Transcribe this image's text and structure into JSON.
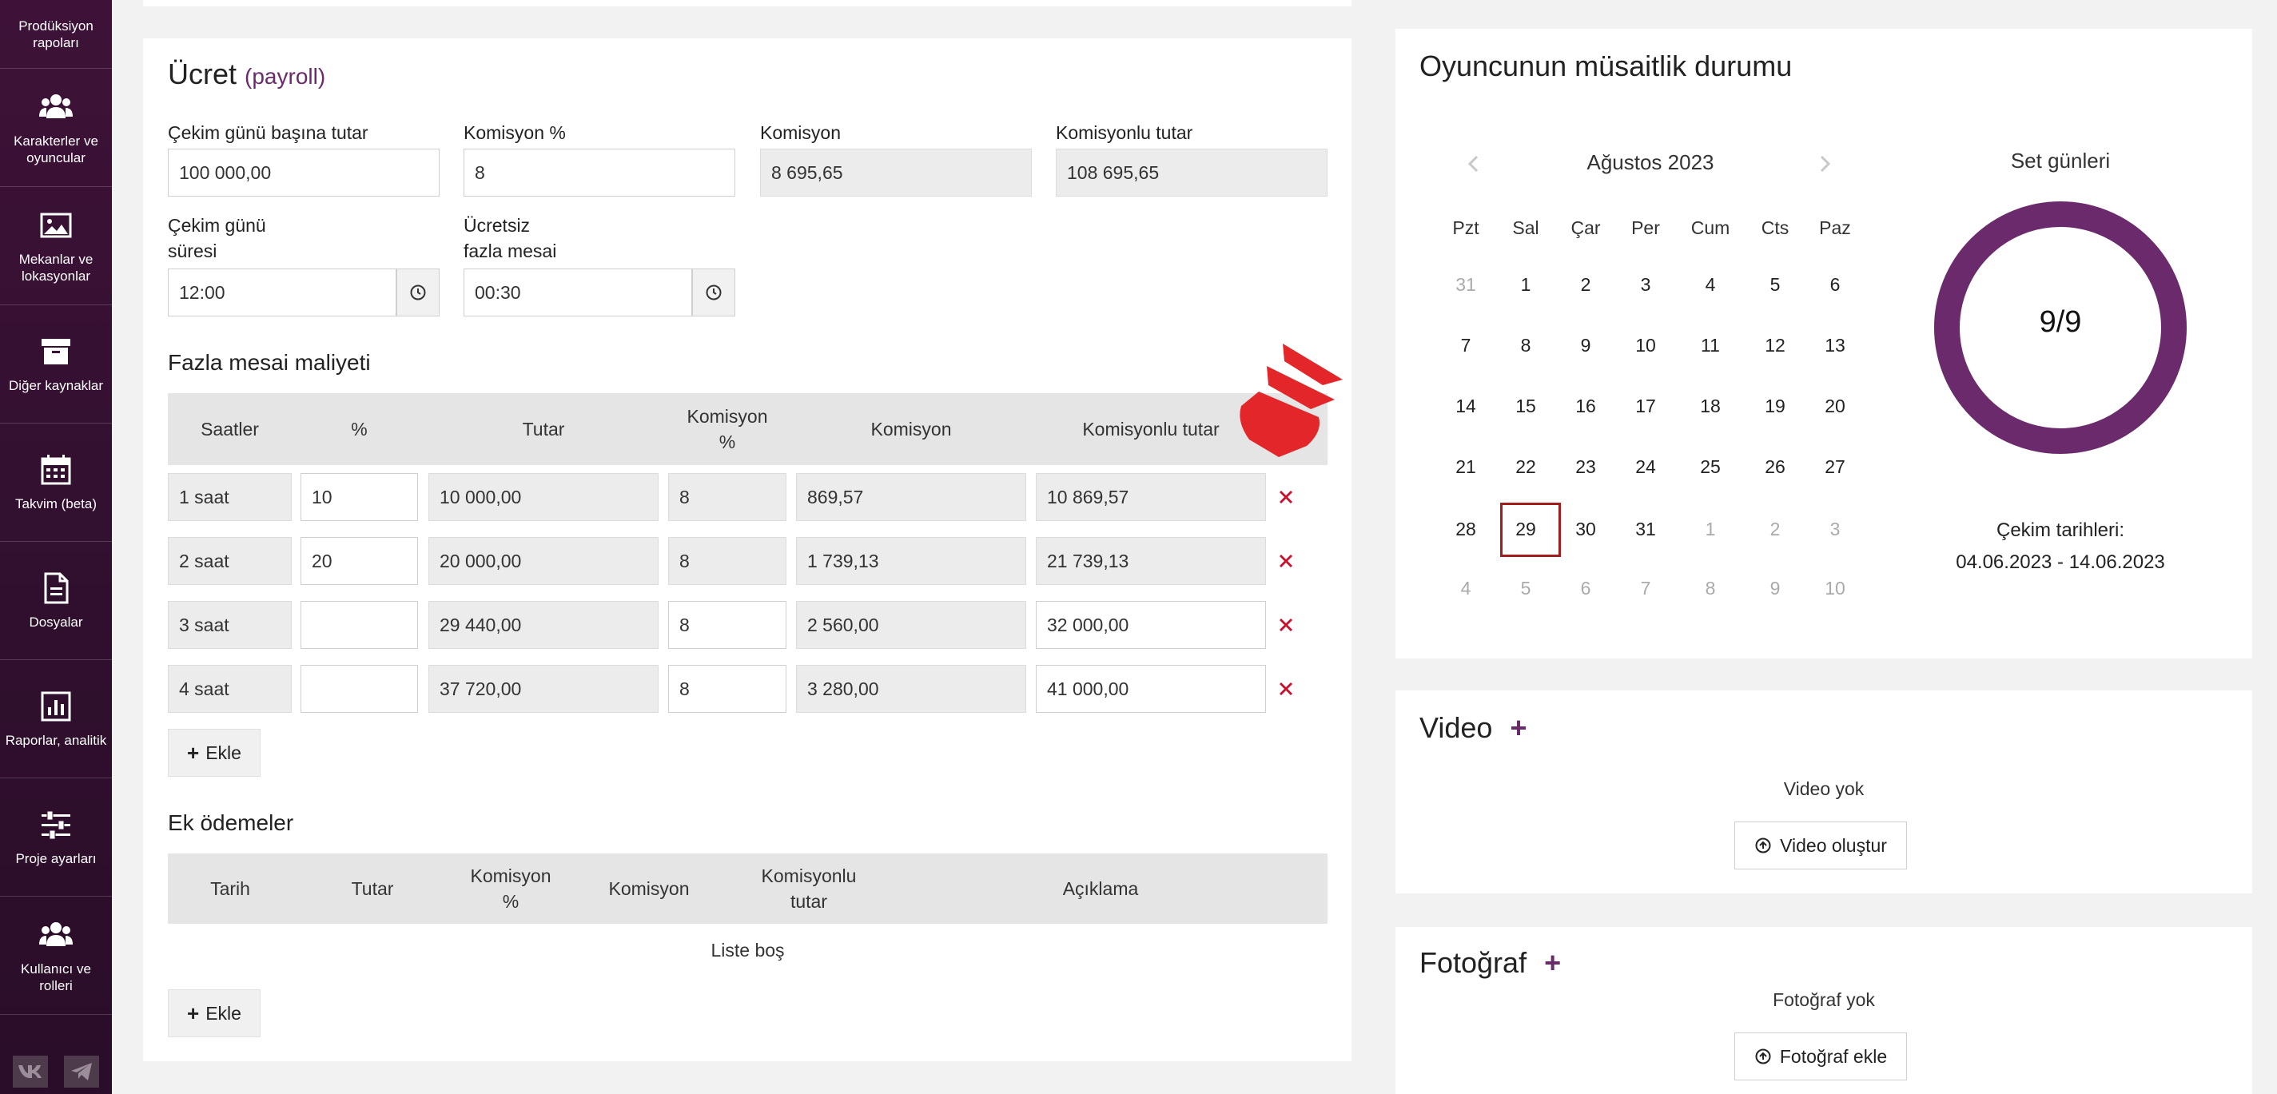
{
  "sidebar": {
    "items": [
      {
        "label": "Prodüksiyon rapoları",
        "icon": "document-icon"
      },
      {
        "label": "Karakterler ve oyuncular",
        "icon": "users-icon"
      },
      {
        "label": "Mekanlar ve lokasyonlar",
        "icon": "image-icon"
      },
      {
        "label": "Diğer kaynaklar",
        "icon": "archive-icon"
      },
      {
        "label": "Takvim (beta)",
        "icon": "calendar-icon"
      },
      {
        "label": "Dosyalar",
        "icon": "file-icon"
      },
      {
        "label": "Raporlar, analitik",
        "icon": "bar-chart-icon"
      },
      {
        "label": "Proje ayarları",
        "icon": "sliders-icon"
      },
      {
        "label": "Kullanıcı ve rolleri",
        "icon": "users-icon"
      }
    ],
    "social": [
      "vk-icon",
      "telegram-icon"
    ]
  },
  "fee": {
    "title": "Ücret",
    "subtitle": "(payroll)",
    "per_day_label": "Çekim günü başına tutar",
    "per_day_value": "100 000,00",
    "commission_pct_label": "Komisyon %",
    "commission_pct_value": "8",
    "commission_label": "Komisyon",
    "commission_value": "8 695,65",
    "with_commission_label": "Komisyonlu tutar",
    "with_commission_value": "108 695,65",
    "day_duration_label_1": "Çekim günü",
    "day_duration_label_2": "süresi",
    "day_duration_value": "12:00",
    "free_overtime_label_1": "Ücretsiz",
    "free_overtime_label_2": "fazla mesai",
    "free_overtime_value": "00:30"
  },
  "overtime": {
    "title": "Fazla mesai maliyeti",
    "headers": {
      "hours": "Saatler",
      "pct": "%",
      "amount": "Tutar",
      "comm_pct_1": "Komisyon",
      "comm_pct_2": "%",
      "comm": "Komisyon",
      "total": "Komisyonlu tutar"
    },
    "rows": [
      {
        "hours": "1 saat",
        "pct": "10",
        "amount": "10 000,00",
        "comm_pct": "8",
        "comm": "869,57",
        "total": "10 869,57"
      },
      {
        "hours": "2 saat",
        "pct": "20",
        "amount": "20 000,00",
        "comm_pct": "8",
        "comm": "1 739,13",
        "total": "21 739,13"
      },
      {
        "hours": "3 saat",
        "pct": "",
        "amount": "29 440,00",
        "comm_pct": "8",
        "comm": "2 560,00",
        "total": "32 000,00"
      },
      {
        "hours": "4 saat",
        "pct": "",
        "amount": "37 720,00",
        "comm_pct": "8",
        "comm": "3 280,00",
        "total": "41 000,00"
      }
    ],
    "add_label": "Ekle"
  },
  "extras": {
    "title": "Ek ödemeler",
    "headers": {
      "date": "Tarih",
      "amount": "Tutar",
      "comm_pct_1": "Komisyon",
      "comm_pct_2": "%",
      "comm": "Komisyon",
      "total_1": "Komisyonlu",
      "total_2": "tutar",
      "desc": "Açıklama"
    },
    "empty": "Liste boş",
    "add_label": "Ekle"
  },
  "availability": {
    "title": "Oyuncunun müsaitlik durumu",
    "month": "Ağustos 2023",
    "weekdays": [
      "Pzt",
      "Sal",
      "Çar",
      "Per",
      "Cum",
      "Cts",
      "Paz"
    ],
    "weeks": [
      [
        "31",
        "1",
        "2",
        "3",
        "4",
        "5",
        "6"
      ],
      [
        "7",
        "8",
        "9",
        "10",
        "11",
        "12",
        "13"
      ],
      [
        "14",
        "15",
        "16",
        "17",
        "18",
        "19",
        "20"
      ],
      [
        "21",
        "22",
        "23",
        "24",
        "25",
        "26",
        "27"
      ],
      [
        "28",
        "29",
        "30",
        "31",
        "1",
        "2",
        "3"
      ],
      [
        "4",
        "5",
        "6",
        "7",
        "8",
        "9",
        "10"
      ]
    ],
    "today": "29",
    "set_days_label": "Set günleri",
    "set_days_value": "9/9",
    "set_days_fraction": 1.0,
    "shoot_dates_label": "Çekim tarihleri:",
    "shoot_dates_value": "04.06.2023 - 14.06.2023",
    "accent": "#6b2a6b"
  },
  "video": {
    "title": "Video",
    "empty": "Video yok",
    "button": "Video oluştur"
  },
  "photo": {
    "title": "Fotoğraf",
    "empty": "Fotoğraf yok",
    "button": "Fotoğraf ekle"
  }
}
